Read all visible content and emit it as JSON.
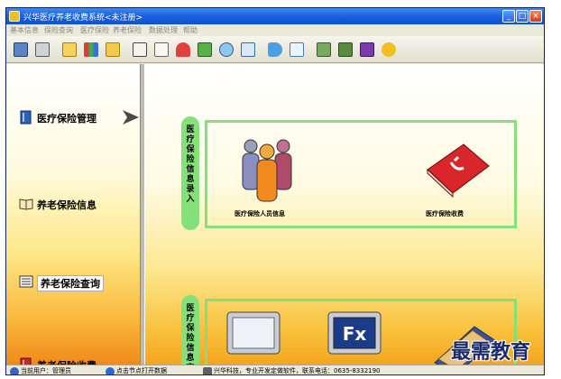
{
  "window": {
    "title": "兴华医疗养老收费系统<未注册>",
    "controls": {
      "minimize": "_",
      "maximize": "□",
      "close": "×"
    }
  },
  "menu": [
    {
      "label": "基本信息"
    },
    {
      "label": "保险查询"
    },
    {
      "label": "医疗保险"
    },
    {
      "label": "养老保险"
    },
    {
      "label": "数据处理"
    },
    {
      "label": "帮助"
    }
  ],
  "toolbar": {
    "icons": [
      "monitor-icon",
      "printer-icon",
      "folder-icon",
      "colored-blocks-icon",
      "folder-open-icon",
      "document-edit-icon",
      "document-write-icon",
      "umbrella-icon",
      "book-icon",
      "magnifier-icon",
      "brush-icon",
      "horn-icon",
      "note-icon",
      "picture-icon",
      "pencil-icon",
      "help-book-icon",
      "runner-icon"
    ]
  },
  "nav": [
    {
      "label": "医疗保险管理",
      "icon": "book-blue-icon"
    },
    {
      "label": "养老保险信息",
      "icon": "book-open-icon"
    },
    {
      "label": "养老保险查询",
      "icon": "ledger-icon"
    },
    {
      "label": "养老保险收费",
      "icon": "book-red-icon"
    }
  ],
  "sections": [
    {
      "tab": "医疗保险信息录入",
      "modules": [
        {
          "label": "医疗保险人员信息",
          "icon": "people-group-icon"
        },
        {
          "label": "医疗保险收费",
          "icon": "red-book-icon"
        }
      ]
    },
    {
      "tab": "医疗保险信息查询",
      "modules": [
        {
          "label": "",
          "icon": "monitor-icon"
        },
        {
          "label": "",
          "icon": "fx-monitor-icon"
        },
        {
          "label": "",
          "icon": "folder-book-icon"
        }
      ]
    }
  ],
  "status": [
    {
      "text": "当前用户：管理员"
    },
    {
      "text": "点击节点打开数据"
    },
    {
      "text": "兴华科技，专业开发定做软件，联系电话：0635-8332190"
    }
  ],
  "watermark": "最需教育",
  "colors": {
    "titlebar": "#1f63e0",
    "section_green": "#86e07a",
    "panel_orange": "#f9b83a"
  }
}
